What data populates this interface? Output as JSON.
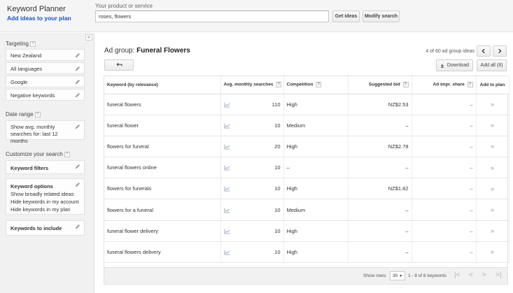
{
  "app": {
    "title": "Keyword Planner",
    "subtitle": "Add ideas to your plan"
  },
  "search": {
    "label": "Your product or service",
    "value": "roses, flowers",
    "get_ideas": "Get ideas",
    "modify": "Modify search"
  },
  "sidebar": {
    "collapse_glyph": "«",
    "targeting_label": "Targeting",
    "targeting": [
      "New Zealand",
      "All languages",
      "Google",
      "Negative keywords"
    ],
    "date_range_label": "Date range",
    "date_range_value": "Show avg. monthly searches for: last 12 months",
    "customize_label": "Customize your search",
    "keyword_filters": "Keyword filters",
    "keyword_options_title": "Keyword options",
    "keyword_options": [
      "Show broadly related ideas",
      "Hide keywords in my account",
      "Hide keywords in my plan"
    ],
    "keywords_to_include": "Keywords to include",
    "help_glyph": "?"
  },
  "main": {
    "adgroup_prefix": "Ad group:",
    "adgroup_name": "Funeral Flowers",
    "ideas_count": "4 of 60 ad group ideas",
    "download": "Download",
    "add_all": "Add all (8)"
  },
  "table": {
    "headers": {
      "keyword": "Keyword (by relevance)",
      "searches": "Avg. monthly searches",
      "competition": "Competition",
      "bid": "Suggested bid",
      "share": "Ad impr. share",
      "add": "Add to plan"
    },
    "rows": [
      {
        "keyword": "funeral flowers",
        "searches": "110",
        "competition": "High",
        "bid": "NZ$2.53",
        "share": "–"
      },
      {
        "keyword": "funeral flower",
        "searches": "10",
        "competition": "Medium",
        "bid": "–",
        "share": "–"
      },
      {
        "keyword": "flowers for funeral",
        "searches": "20",
        "competition": "High",
        "bid": "NZ$2.78",
        "share": "–"
      },
      {
        "keyword": "funeral flowers online",
        "searches": "10",
        "competition": "–",
        "bid": "–",
        "share": "–"
      },
      {
        "keyword": "flowers for funerals",
        "searches": "10",
        "competition": "High",
        "bid": "NZ$1.82",
        "share": "–"
      },
      {
        "keyword": "flowers for a funeral",
        "searches": "10",
        "competition": "Medium",
        "bid": "–",
        "share": "–"
      },
      {
        "keyword": "funeral flower delivery",
        "searches": "10",
        "competition": "High",
        "bid": "–",
        "share": "–"
      },
      {
        "keyword": "funeral flowers delivery",
        "searches": "10",
        "competition": "High",
        "bid": "–",
        "share": "–"
      }
    ]
  },
  "footer": {
    "show_rows_label": "Show rows:",
    "rows_value": "30",
    "range_text": "1 - 8 of 8 keywords"
  },
  "icons": [
    "pencil-icon",
    "help-icon",
    "back-arrow-icon",
    "chevron-left-icon",
    "chevron-right-icon",
    "download-icon",
    "trend-chart-icon",
    "add-chevron-icon",
    "first-page-icon",
    "last-page-icon"
  ],
  "colors": {
    "link": "#1155cc",
    "header_bg": "#f5f5f5",
    "sidebar_bg": "#f1f1f1"
  }
}
